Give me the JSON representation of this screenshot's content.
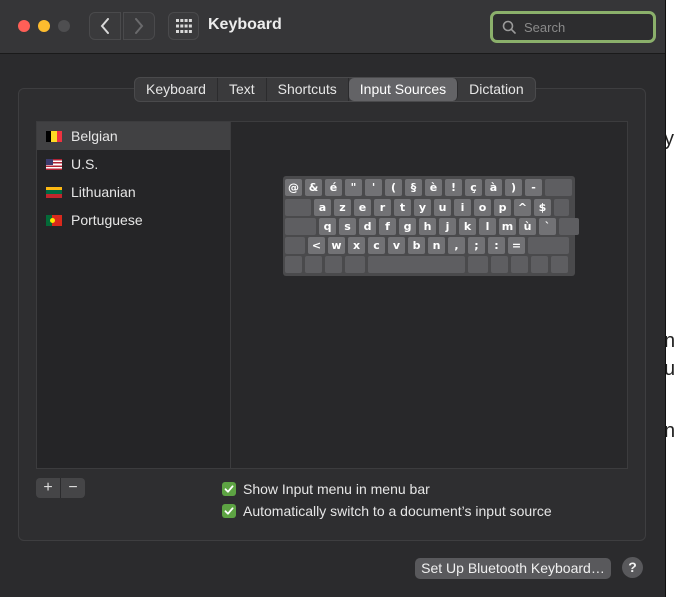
{
  "window": {
    "title": "Keyboard"
  },
  "search": {
    "placeholder": "Search"
  },
  "tabs": [
    {
      "label": "Keyboard"
    },
    {
      "label": "Text"
    },
    {
      "label": "Shortcuts"
    },
    {
      "label": "Input Sources"
    },
    {
      "label": "Dictation"
    }
  ],
  "active_tab": "Input Sources",
  "input_sources": [
    {
      "label": "Belgian",
      "selected": true
    },
    {
      "label": "U.S.",
      "selected": false
    },
    {
      "label": "Lithuanian",
      "selected": false
    },
    {
      "label": "Portuguese",
      "selected": false
    }
  ],
  "keyboard_rows": [
    [
      "@",
      "&",
      "é",
      "\"",
      "'",
      "(",
      "§",
      "è",
      "!",
      "ç",
      "à",
      ")",
      "-"
    ],
    [
      "a",
      "z",
      "e",
      "r",
      "t",
      "y",
      "u",
      "i",
      "o",
      "p",
      "^",
      "$"
    ],
    [
      "q",
      "s",
      "d",
      "f",
      "g",
      "h",
      "j",
      "k",
      "l",
      "m",
      "ù",
      "`"
    ],
    [
      "<",
      "w",
      "x",
      "c",
      "v",
      "b",
      "n",
      ",",
      ";",
      ":",
      "="
    ]
  ],
  "controls": {
    "add_label": "+",
    "remove_label": "−"
  },
  "options": [
    {
      "label": "Show Input menu in menu bar",
      "checked": true
    },
    {
      "label": "Automatically switch to a document’s input source",
      "checked": true
    }
  ],
  "buttons": {
    "bluetooth_label": "Set Up Bluetooth Keyboard…",
    "help_label": "?"
  },
  "colors": {
    "accent": "#5da343",
    "search_ring": "#8bb06b"
  }
}
